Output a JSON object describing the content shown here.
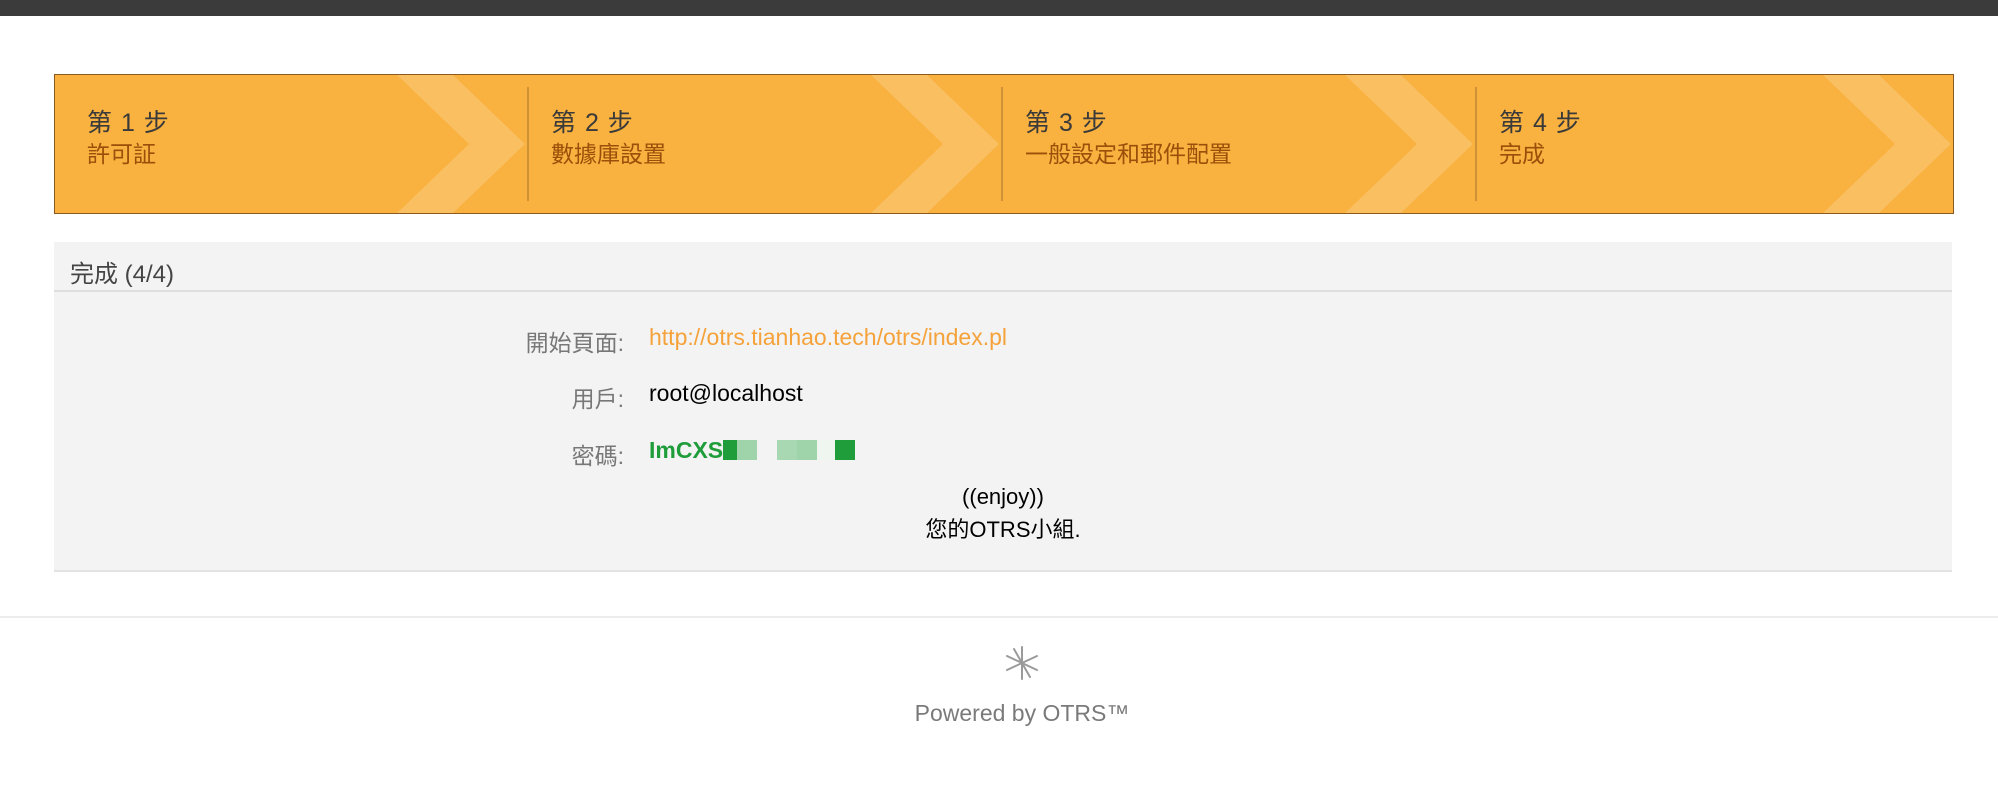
{
  "steps": [
    {
      "number": "第 1 步",
      "label": "許可証"
    },
    {
      "number": "第 2 步",
      "label": "數據庫設置"
    },
    {
      "number": "第 3 步",
      "label": "一般設定和郵件配置"
    },
    {
      "number": "第 4 步",
      "label": "完成"
    }
  ],
  "panel": {
    "title": "完成 (4/4)",
    "start_page_label": "開始頁面:",
    "start_page_url": "http://otrs.tianhao.tech/otrs/index.pl",
    "user_label": "用戶:",
    "user_value": "root@localhost",
    "password_label": "密碼:",
    "password_visible": "ImCXS",
    "enjoy": "((enjoy))",
    "signature": "您的OTRS小組."
  },
  "footer": {
    "powered_by": "Powered by OTRS™",
    "logo_icon": "otrs-logo-icon"
  },
  "colors": {
    "steps_bg": "#f9b13f",
    "link": "#f5a23a",
    "password": "#1f9d3a"
  }
}
